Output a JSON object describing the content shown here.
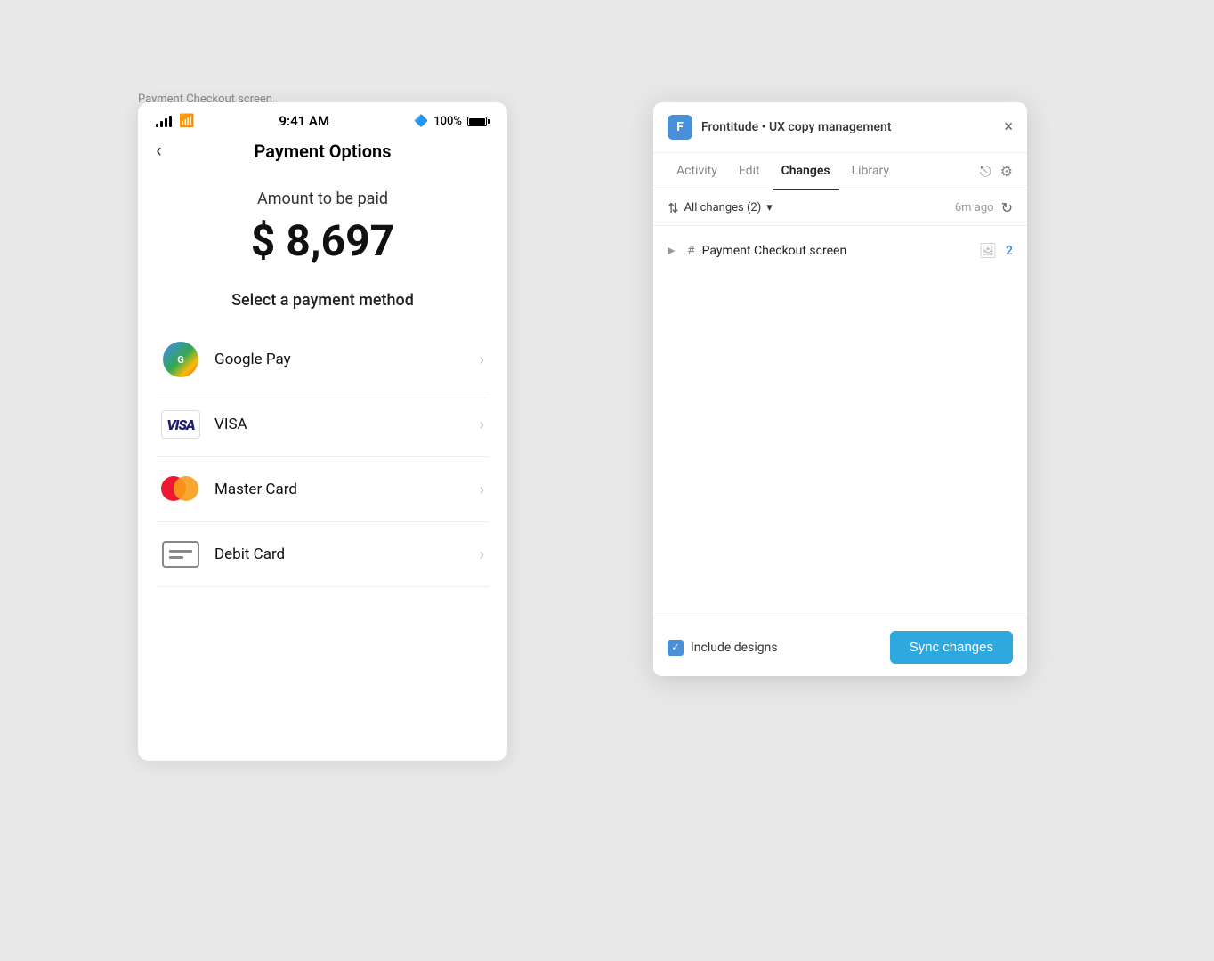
{
  "page": {
    "label": "Payment Checkout screen",
    "background": "#e8e8e8"
  },
  "mobile": {
    "status": {
      "time": "9:41 AM",
      "battery_percent": "100%",
      "bluetooth": "BT"
    },
    "nav": {
      "title": "Payment Options",
      "back_label": "‹"
    },
    "amount": {
      "label": "Amount to be paid",
      "value": "$ 8,697"
    },
    "select_label": "Select a payment method",
    "payment_methods": [
      {
        "id": "google-pay",
        "name": "Google Pay",
        "icon_type": "gpay"
      },
      {
        "id": "visa",
        "name": "VISA",
        "icon_type": "visa"
      },
      {
        "id": "master-card",
        "name": "Master Card",
        "icon_type": "mastercard"
      },
      {
        "id": "debit-card",
        "name": "Debit Card",
        "icon_type": "debit"
      }
    ]
  },
  "panel": {
    "app_name": "Frontitude • UX copy management",
    "logo_letter": "F",
    "close_label": "×",
    "tabs": [
      {
        "id": "activity",
        "label": "Activity",
        "active": false
      },
      {
        "id": "edit",
        "label": "Edit",
        "active": false
      },
      {
        "id": "changes",
        "label": "Changes",
        "active": true
      },
      {
        "id": "library",
        "label": "Library",
        "active": false
      }
    ],
    "toolbar": {
      "filter_label": "All changes (2)",
      "filter_chevron": "▾",
      "time_ago": "6m ago",
      "sort_icon": "⇅"
    },
    "changes": [
      {
        "id": "payment-checkout-screen",
        "name": "Payment Checkout screen",
        "count": "2"
      }
    ],
    "footer": {
      "include_designs_label": "Include designs",
      "sync_button_label": "Sync changes"
    }
  }
}
